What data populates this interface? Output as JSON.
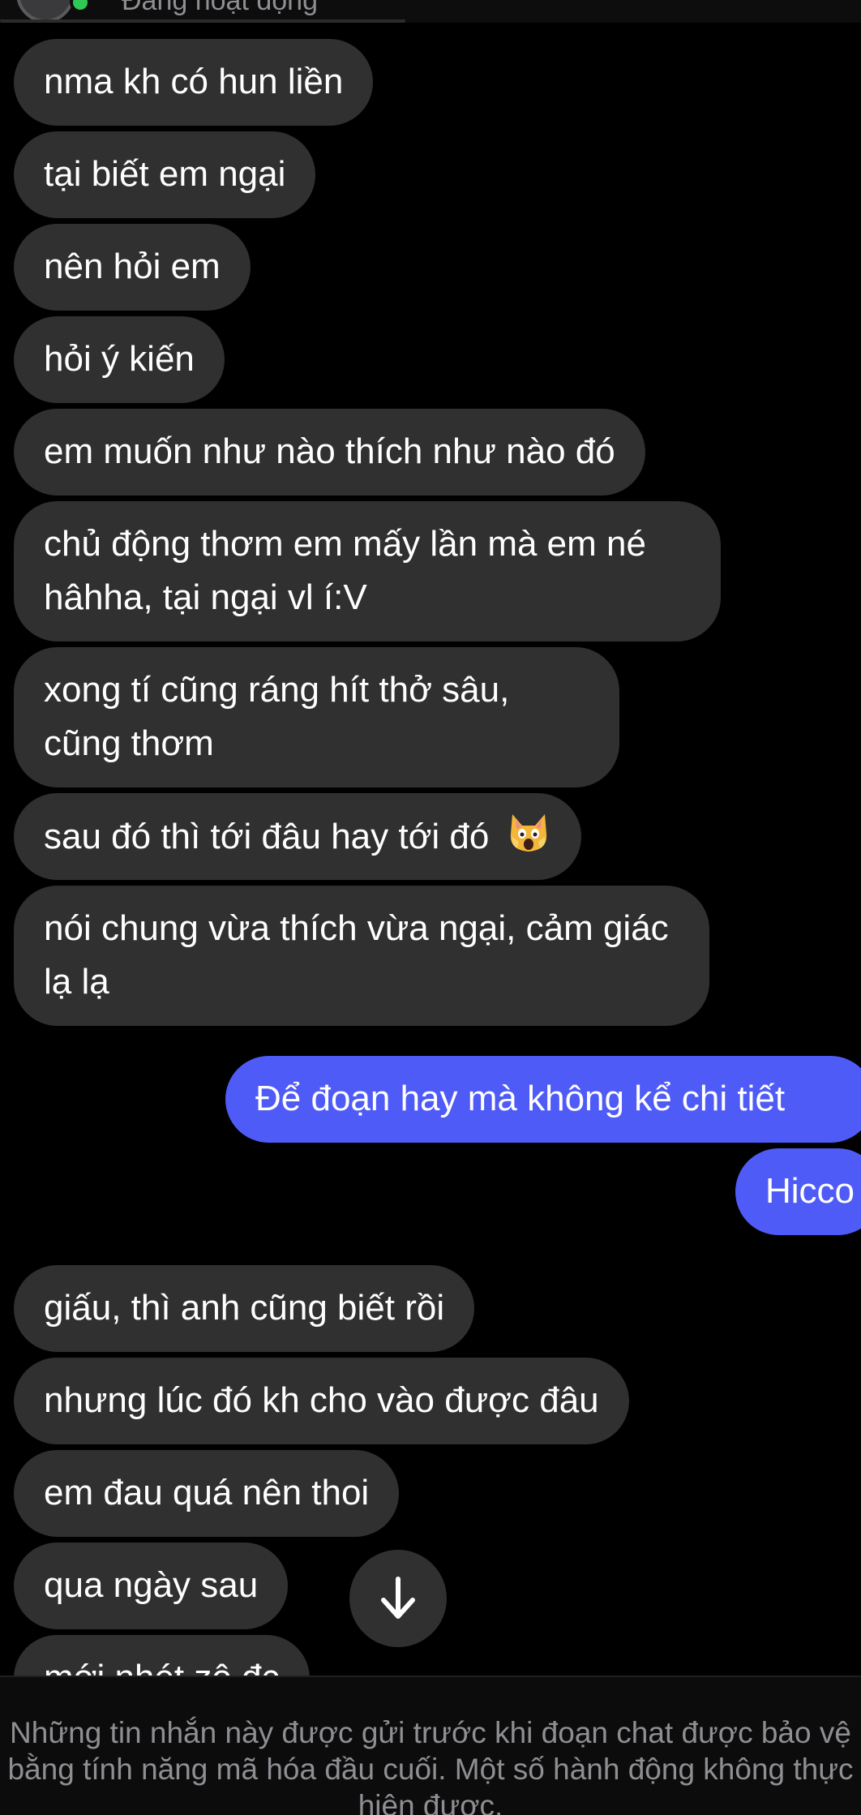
{
  "header": {
    "status_text": "Đang hoạt động"
  },
  "messages": {
    "incoming_top": [
      "nma kh có hun liền",
      "tại biết em ngại",
      "nên hỏi em",
      "hỏi ý kiến",
      "em muốn như nào thích như nào đó",
      "chủ động thơm em mấy lần mà em né hâhha, tại ngại vl í:V",
      "xong tí cũng ráng hít thở sâu, cũng thơm",
      "sau đó thì tới đâu hay tới đó",
      "nói chung vừa thích vừa ngại, cảm giác lạ lạ"
    ],
    "outgoing": [
      "Để đoạn hay mà không kể chi tiết",
      "Hicco"
    ],
    "incoming_bottom": [
      "giấu, thì anh cũng biết rồi",
      "nhưng lúc đó kh cho vào được đâu",
      "em đau quá nên thoi",
      "qua ngày sau",
      "mới nhét zô đc"
    ]
  },
  "emoji": {
    "name": "face-screaming-in-fear-cat-emoji"
  },
  "scroll_button": {
    "icon": "arrow-down-icon"
  },
  "notice": {
    "text": "Những tin nhắn này được gửi trước khi đoạn chat được bảo vệ bằng tính năng mã hóa đầu cuối. Một số hành động không thực hiện được."
  },
  "colors": {
    "background": "#000000",
    "incoming_bubble": "#303030",
    "outgoing_bubble": "#4f5bf7",
    "online": "#31c755",
    "muted_text": "#8e8e93"
  }
}
